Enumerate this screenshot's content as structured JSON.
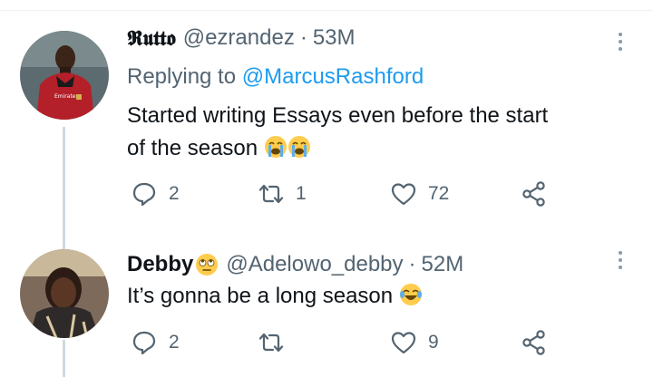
{
  "tweets": [
    {
      "display_name": "𝕽𝖚𝖙𝖙𝖔",
      "handle": "@ezrandez",
      "separator": "·",
      "time": "53M",
      "replying_prefix": "Replying to",
      "replying_to": "@MarcusRashford",
      "text_line1": "Started writing Essays even before the start",
      "text_line2": "of the season",
      "emojis": [
        "loudly-crying-face",
        "loudly-crying-face"
      ],
      "reply_count": "2",
      "retweet_count": "1",
      "like_count": "72",
      "jersey_text": "Emirates"
    },
    {
      "display_name": "Debby",
      "name_emoji": "face-with-rolling-eyes",
      "handle": "@Adelowo_debby",
      "separator": "·",
      "time": "52M",
      "text_line1": "It’s gonna be a long season",
      "emojis": [
        "face-with-tears-of-joy"
      ],
      "reply_count": "2",
      "retweet_count": "",
      "like_count": "9"
    }
  ],
  "colors": {
    "text_primary": "#0f1419",
    "text_secondary": "#536471",
    "link": "#1d9bf0",
    "thread_line": "#cfd9de"
  }
}
